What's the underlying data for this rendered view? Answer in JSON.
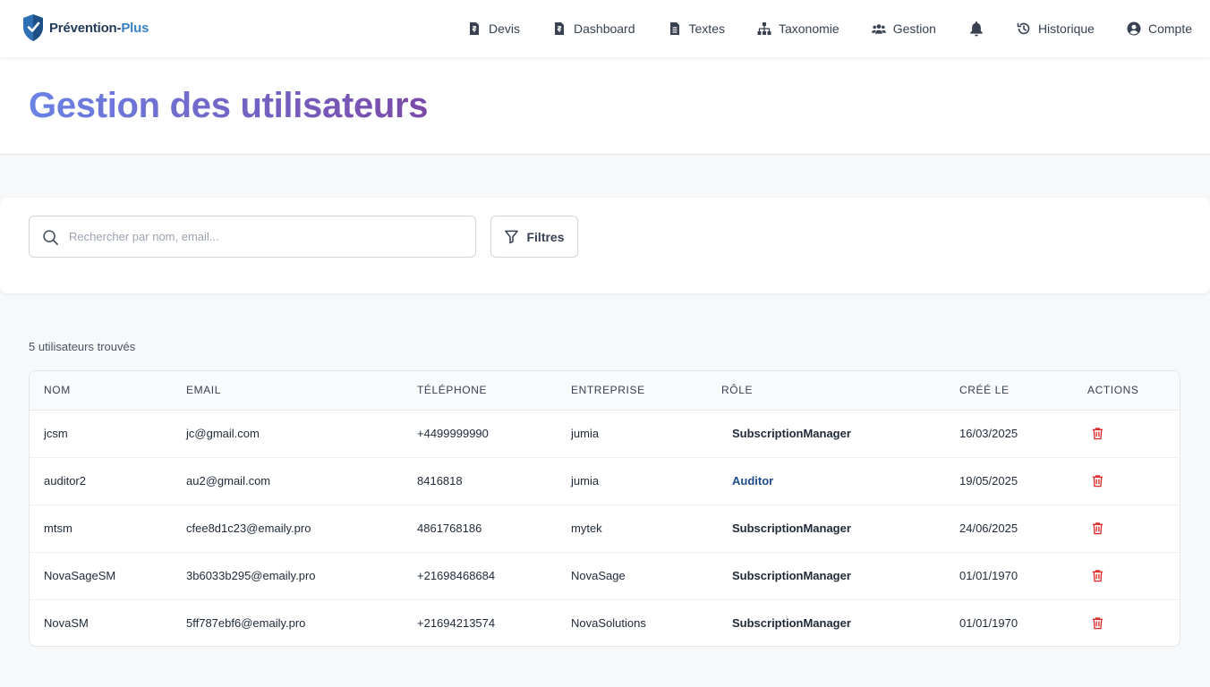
{
  "brand": {
    "name_main": "Prévention-",
    "name_accent": "Plus",
    "accent_color": "#3b82c4",
    "shield_color": "#2f6fb3"
  },
  "nav": {
    "items": [
      {
        "label": "Devis",
        "icon": "file-dollar-icon"
      },
      {
        "label": "Dashboard",
        "icon": "file-dollar-icon"
      },
      {
        "label": "Textes",
        "icon": "file-text-icon"
      },
      {
        "label": "Taxonomie",
        "icon": "sitemap-icon"
      },
      {
        "label": "Gestion",
        "icon": "users-icon"
      },
      {
        "label": "",
        "icon": "bell-icon"
      },
      {
        "label": "Historique",
        "icon": "history-icon"
      },
      {
        "label": "Compte",
        "icon": "user-circle-icon"
      }
    ]
  },
  "page": {
    "title": "Gestion des utilisateurs"
  },
  "search": {
    "placeholder": "Rechercher par nom, email...",
    "value": "",
    "filter_label": "Filtres"
  },
  "results": {
    "count_text": "5 utilisateurs trouvés"
  },
  "table": {
    "headers": [
      "NOM",
      "EMAIL",
      "TÉLÉPHONE",
      "ENTREPRISE",
      "RÔLE",
      "CRÉÉ LE",
      "ACTIONS"
    ],
    "rows": [
      {
        "name": "jcsm",
        "email": "jc@gmail.com",
        "phone": "+4499999990",
        "company": "jumia",
        "role": "SubscriptionManager",
        "created": "16/03/2025"
      },
      {
        "name": "auditor2",
        "email": "au2@gmail.com",
        "phone": "8416818",
        "company": "jumia",
        "role": "Auditor",
        "created": "19/05/2025"
      },
      {
        "name": "mtsm",
        "email": "cfee8d1c23@emaily.pro",
        "phone": "4861768186",
        "company": "mytek",
        "role": "SubscriptionManager",
        "created": "24/06/2025"
      },
      {
        "name": "NovaSageSM",
        "email": "3b6033b295@emaily.pro",
        "phone": "+21698468684",
        "company": "NovaSage",
        "role": "SubscriptionManager",
        "created": "01/01/1970"
      },
      {
        "name": "NovaSM",
        "email": "5ff787ebf6@emaily.pro",
        "phone": "+21694213574",
        "company": "NovaSolutions",
        "role": "SubscriptionManager",
        "created": "01/01/1970"
      }
    ]
  },
  "colors": {
    "title_gradient_start": "#6a82e6",
    "title_gradient_end": "#7b4aa8",
    "delete": "#dc2626",
    "auditor_role": "#1e4b8c"
  }
}
